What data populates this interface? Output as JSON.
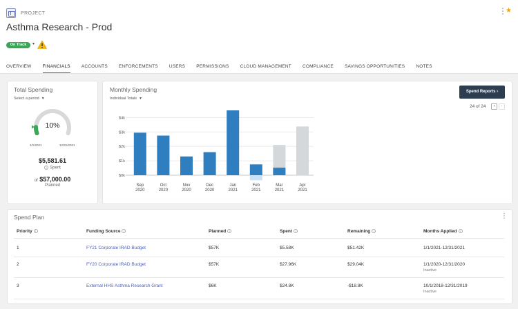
{
  "header": {
    "project_label": "PROJECT",
    "title": "Asthma Research - Prod",
    "status_badge": "On Track"
  },
  "tabs": [
    {
      "label": "OVERVIEW"
    },
    {
      "label": "FINANCIALS",
      "active": true
    },
    {
      "label": "ACCOUNTS"
    },
    {
      "label": "ENFORCEMENTS"
    },
    {
      "label": "USERS"
    },
    {
      "label": "PERMISSIONS"
    },
    {
      "label": "CLOUD MANAGEMENT"
    },
    {
      "label": "COMPLIANCE"
    },
    {
      "label": "SAVINGS OPPORTUNITIES"
    },
    {
      "label": "NOTES"
    }
  ],
  "total_spending": {
    "title": "Total Spending",
    "period_select": "Select a period",
    "percent": "10%",
    "percent_value": 0.1,
    "start_date": "1/1/2021",
    "end_date": "12/31/2021",
    "spent_value": "$5,581.61",
    "spent_label": "Spent",
    "planned_prefix": "of",
    "planned_value": "$57,000.00",
    "planned_label": "Planned"
  },
  "monthly_spending": {
    "title": "Monthly Spending",
    "view_select": "Individual Totals",
    "button_label": "Spend Reports",
    "pager_text": "24 of 24",
    "colors": {
      "actual": "#2f7ebf",
      "planned": "#d5d8da",
      "forecast": "#c9e0f5"
    }
  },
  "chart_data": {
    "type": "bar",
    "categories": [
      "Sep 2020",
      "Oct 2020",
      "Nov 2020",
      "Dec 2020",
      "Jan 2021",
      "Feb 2021",
      "Mar 2021",
      "Apr 2021"
    ],
    "y_ticks": [
      "$0k",
      "$1k",
      "$2k",
      "$3k",
      "$4k"
    ],
    "ylim": [
      0,
      4500
    ],
    "series": [
      {
        "values": [
          2950,
          2750,
          1300,
          1600,
          4650,
          750,
          520,
          null
        ]
      },
      {
        "values": [
          null,
          null,
          null,
          null,
          null,
          null,
          2100,
          3380
        ]
      },
      {
        "values": [
          null,
          null,
          null,
          null,
          null,
          -350,
          null,
          null
        ]
      }
    ]
  },
  "spend_plan": {
    "title": "Spend Plan",
    "columns": [
      "Priority",
      "Funding Source",
      "Planned",
      "Spent",
      "Remaining",
      "Months Applied"
    ],
    "rows": [
      {
        "priority": "1",
        "source": "FY21 Corporate IRAD Budget",
        "planned": "$57K",
        "spent": "$5.58K",
        "remaining": "$51.42K",
        "months": "1/1/2021-12/31/2021",
        "status": ""
      },
      {
        "priority": "2",
        "source": "FY20 Corporate IRAD Budget",
        "planned": "$57K",
        "spent": "$27.96K",
        "remaining": "$29.04K",
        "months": "1/1/2020-12/31/2020",
        "status": "Inactive"
      },
      {
        "priority": "3",
        "source": "External HHS Asthma Research Grant",
        "planned": "$6K",
        "spent": "$24.8K",
        "remaining": "-$18.8K",
        "months": "10/1/2018-12/31/2019",
        "status": "Inactive"
      }
    ]
  }
}
